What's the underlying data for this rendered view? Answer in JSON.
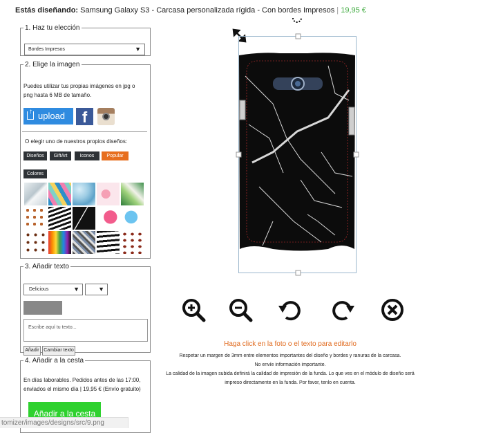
{
  "header": {
    "prefix": "Estás diseñando:",
    "product": "Samsung Galaxy S3 - Carcasa personalizada rígida - Con bordes Impresos",
    "separator": "|",
    "price": "19,95 €"
  },
  "step1": {
    "legend": "1. Haz tu elección",
    "selected": "Bordes Impresos"
  },
  "step2": {
    "legend": "2. Elige la imagen",
    "help": "Puedes utilizar tus propias imágenes en jpg o png hasta 6 MB de tamaño.",
    "upload_label": "upload",
    "facebook_label": "f",
    "or_text": "O elegir uno de nuestros propios diseños:",
    "categories": [
      "Diseños",
      "GiftArt",
      "Iconos",
      "Popular",
      "Colores"
    ],
    "active_category": "Popular"
  },
  "step3": {
    "legend": "3. Añadir texto",
    "font": "Delicious",
    "placeholder": "Escribe aquí tu texto...",
    "add_btn": "Añadir",
    "change_btn": "Cambiar texto"
  },
  "step4": {
    "legend": "4. Añadir a la cesta",
    "info": "En días laborables. Pedidos antes de las 17:00, enviados el mismo día | 19,95 € (Envío gratuito)",
    "cart_btn": "Añadir a la cesta"
  },
  "status_url": "tomizer/images/designs/src/9.png",
  "tools": [
    "zoom-in-icon",
    "zoom-out-icon",
    "rotate-left-icon",
    "rotate-right-icon",
    "delete-icon"
  ],
  "hint": {
    "title": "Haga click en la foto o el texto para editarlo",
    "line1": "Respetar un margen de 3mm entre elementos importantes del diseño y bordes y ranuras de la carcasa. No envíe información importante.",
    "line2": "La calidad de la imagen subida definirá la calidad de impresión de la funda. Lo que ves en el módulo de diseño será impreso directamente en la funda. Por favor, tenlo en cuenta."
  },
  "colors": {
    "accent_orange": "#e76e1e",
    "upload_blue": "#2f8be0",
    "cart_green": "#2ed12e",
    "price_green": "#3aa83a"
  }
}
